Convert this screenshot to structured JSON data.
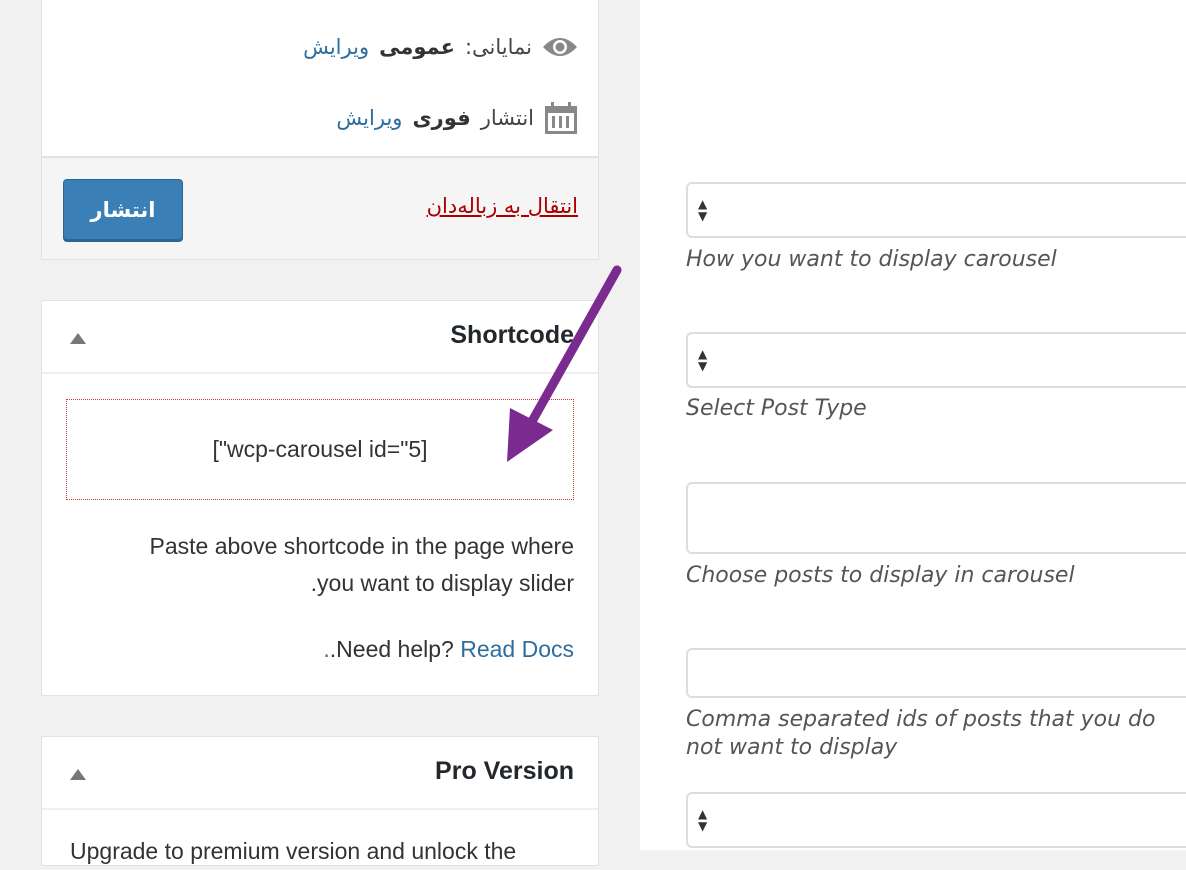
{
  "publish": {
    "visibility_label": "نمایانی:",
    "visibility_value": "عمومی",
    "visibility_edit": "ویرایش",
    "schedule_label": "انتشار",
    "schedule_value": "فوری",
    "schedule_edit": "ویرایش",
    "trash_link": "انتقال به زباله‌دان",
    "publish_button": "انتشار"
  },
  "shortcode": {
    "title": "Shortcode",
    "code": "[\"wcp-carousel id=\"5]",
    "help_line1": "Paste above shortcode in the page where",
    "help_line2": ".you want to display slider",
    "need_help": ".Need help? ",
    "read_docs": "Read Docs",
    "dot": "."
  },
  "pro": {
    "title": "Pro Version",
    "text": "Upgrade to premium version and unlock the"
  },
  "fields": [
    {
      "description": "How you want to display carousel"
    },
    {
      "description": "Select Post Type"
    },
    {
      "description": "Choose posts to display in carousel"
    },
    {
      "description": "Comma separated ids of posts that you do not want to display"
    },
    {
      "description": ""
    }
  ],
  "colors": {
    "arrow": "#7b2a8f",
    "link": "#2e6e9e",
    "trash": "#aa0000",
    "button": "#3a7fb5"
  }
}
